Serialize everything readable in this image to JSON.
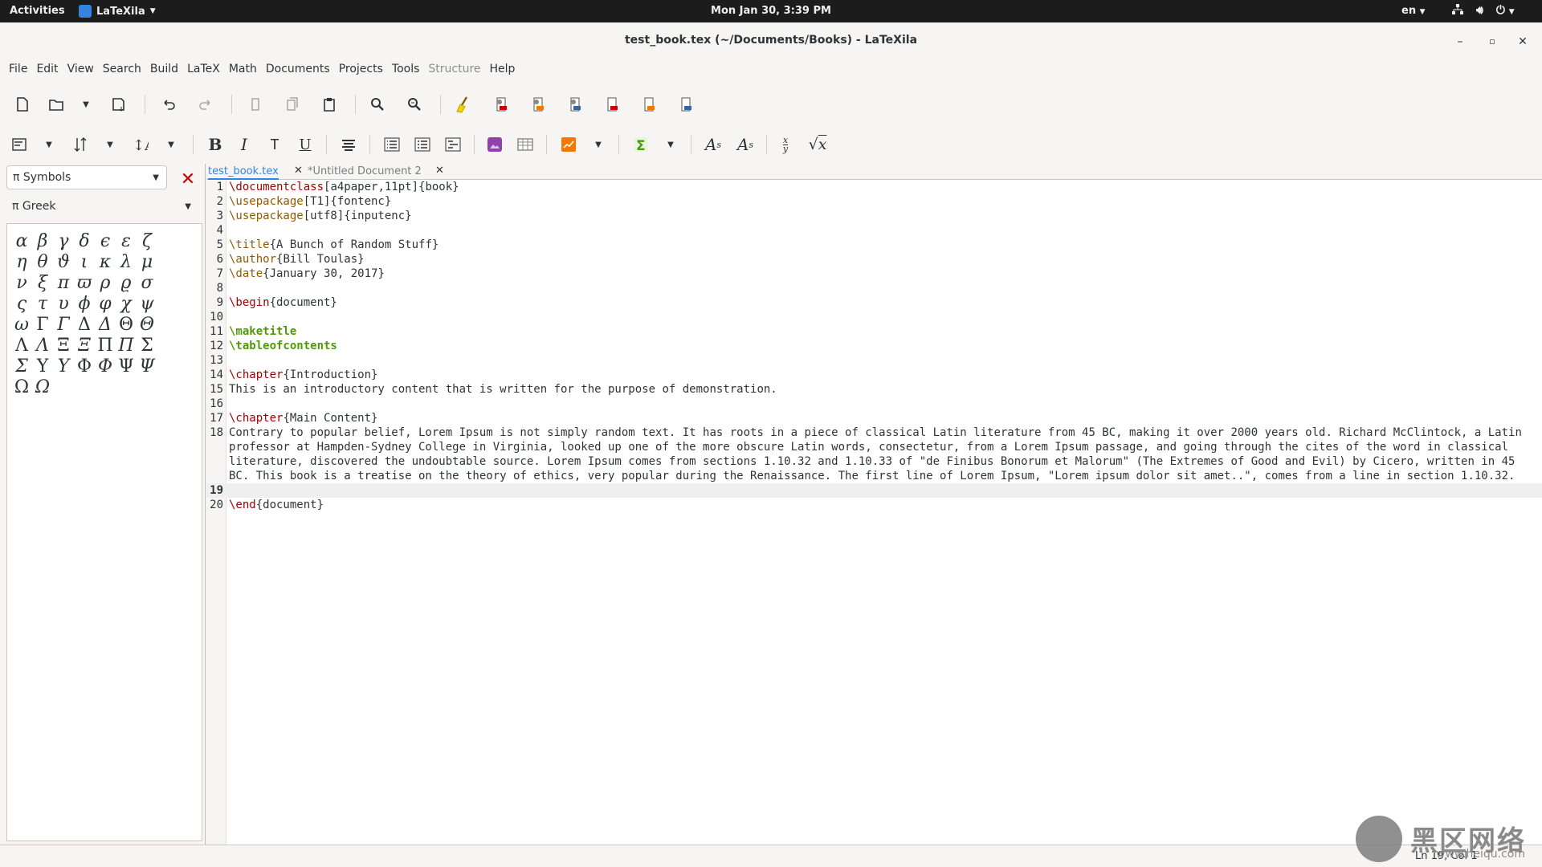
{
  "topbar": {
    "activities": "Activities",
    "app_name": "LaTeXila",
    "clock": "Mon Jan 30,  3:39 PM",
    "lang": "en"
  },
  "window": {
    "title": "test_book.tex (~/Documents/Books) - LaTeXila"
  },
  "menu": [
    "File",
    "Edit",
    "View",
    "Search",
    "Build",
    "LaTeX",
    "Math",
    "Documents",
    "Projects",
    "Tools",
    "Structure",
    "Help"
  ],
  "menu_disabled": "Structure",
  "sidepanel": {
    "category": "π Symbols",
    "subcategory": "π Greek",
    "symbols": [
      "α",
      "β",
      "γ",
      "δ",
      "ϵ",
      "ε",
      "ζ",
      "η",
      "θ",
      "ϑ",
      "ι",
      "κ",
      "λ",
      "μ",
      "ν",
      "ξ",
      "π",
      "ϖ",
      "ρ",
      "ϱ",
      "σ",
      "ς",
      "τ",
      "υ",
      "ϕ",
      "φ",
      "χ",
      "ψ",
      "ω",
      "Γ",
      "Γ",
      "Δ",
      "Δ",
      "Θ",
      "Θ",
      "Λ",
      "Λ",
      "Ξ",
      "Ξ",
      "Π",
      "Π",
      "Σ",
      "Σ",
      "Υ",
      "Υ",
      "Φ",
      "Φ",
      "Ψ",
      "Ψ",
      "Ω",
      "Ω"
    ]
  },
  "tabs": {
    "active": "test_book.tex",
    "inactive": "*Untitled Document 2"
  },
  "code": {
    "current_line": 19,
    "lines": [
      {
        "n": "1",
        "parts": [
          [
            "\\documentclass",
            "red"
          ],
          [
            "[a4paper,11pt]{book}",
            ""
          ]
        ]
      },
      {
        "n": "2",
        "parts": [
          [
            "\\usepackage",
            "brown"
          ],
          [
            "[T1]{fontenc}",
            ""
          ]
        ]
      },
      {
        "n": "3",
        "parts": [
          [
            "\\usepackage",
            "brown"
          ],
          [
            "[utf8]{inputenc}",
            ""
          ]
        ]
      },
      {
        "n": "4",
        "parts": []
      },
      {
        "n": "5",
        "parts": [
          [
            "\\title",
            "brown"
          ],
          [
            "{A Bunch of Random Stuff}",
            ""
          ]
        ]
      },
      {
        "n": "6",
        "parts": [
          [
            "\\author",
            "brown"
          ],
          [
            "{Bill Toulas}",
            ""
          ]
        ]
      },
      {
        "n": "7",
        "parts": [
          [
            "\\date",
            "brown"
          ],
          [
            "{January 30, 2017}",
            ""
          ]
        ]
      },
      {
        "n": "8",
        "parts": []
      },
      {
        "n": "9",
        "parts": [
          [
            "\\begin",
            "red"
          ],
          [
            "{document}",
            ""
          ]
        ]
      },
      {
        "n": "10",
        "parts": []
      },
      {
        "n": "11",
        "parts": [
          [
            "\\maketitle",
            "green"
          ]
        ]
      },
      {
        "n": "12",
        "parts": [
          [
            "\\tableofcontents",
            "green"
          ]
        ]
      },
      {
        "n": "13",
        "parts": []
      },
      {
        "n": "14",
        "parts": [
          [
            "\\chapter",
            "red"
          ],
          [
            "{Introduction}",
            ""
          ]
        ]
      },
      {
        "n": "15",
        "parts": [
          [
            "This is an introductory content that is written for the purpose of demonstration.",
            ""
          ]
        ]
      },
      {
        "n": "16",
        "parts": []
      },
      {
        "n": "17",
        "parts": [
          [
            "\\chapter",
            "red"
          ],
          [
            "{Main Content}",
            ""
          ]
        ]
      },
      {
        "n": "18",
        "parts": [
          [
            "Contrary to popular belief, Lorem Ipsum is not simply random text. It has roots in a piece of classical Latin literature from 45 BC, making it over 2000 years old. Richard McClintock, a Latin professor at Hampden-Sydney College in Virginia, looked up one of the more obscure Latin words, consectetur, from a Lorem Ipsum passage, and going through the cites of the word in classical literature, discovered the undoubtable source. Lorem Ipsum comes from sections 1.10.32 and 1.10.33 of \"de Finibus Bonorum et Malorum\" (The Extremes of Good and Evil) by Cicero, written in 45 BC. This book is a treatise on the theory of ethics, very popular during the Renaissance. The first line of Lorem Ipsum, \"Lorem ipsum dolor sit amet..\", comes from a line in section 1.10.32.",
            ""
          ]
        ]
      },
      {
        "n": "19",
        "parts": []
      },
      {
        "n": "20",
        "parts": [
          [
            "\\end",
            "red"
          ],
          [
            "{document}",
            ""
          ]
        ]
      }
    ]
  },
  "status": {
    "position": "Ln 19, Col 1"
  },
  "watermark": {
    "big": "黑区网络",
    "small": "www.heiqu.com"
  }
}
